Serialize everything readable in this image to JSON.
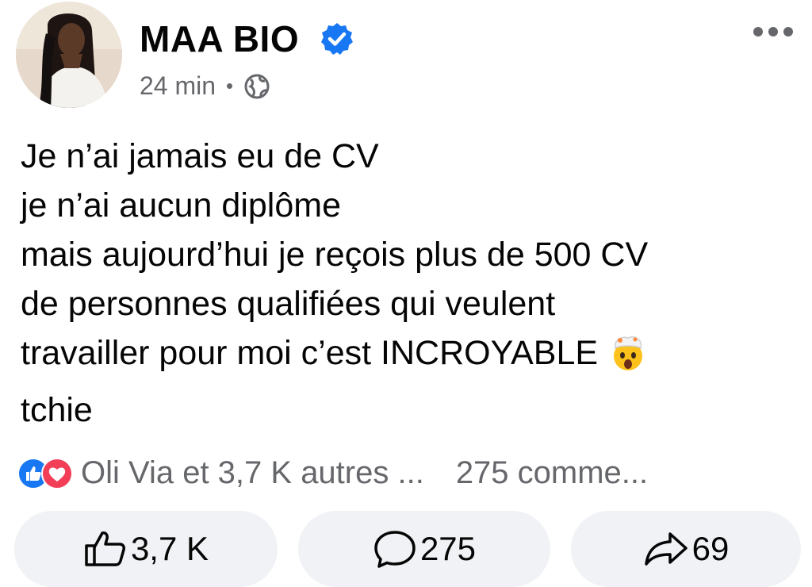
{
  "post": {
    "author_name": "MAA BIO",
    "time": "24 min",
    "lines": [
      "Je n’ai jamais eu de CV",
      "je n’ai aucun diplôme",
      "mais aujourd’hui je reçois plus de 500 CV",
      "de personnes qualifiées qui veulent",
      "travailler pour moi c’est INCROYABLE",
      "tchie"
    ],
    "emoji": "exploding-head-emoji"
  },
  "reactions": {
    "icons": [
      "like-reaction-icon",
      "love-reaction-icon"
    ],
    "summary": "Oli Via et 3,7 K autres ...",
    "comments": "275 comme..."
  },
  "actions": {
    "like_count": "3,7 K",
    "comment_count": "275",
    "share_count": "69"
  },
  "colors": {
    "verified": "#1877f2",
    "like": "#1877f2",
    "love": "#f33e58",
    "button_bg": "#f0f2f5",
    "secondary_text": "#65676b"
  }
}
